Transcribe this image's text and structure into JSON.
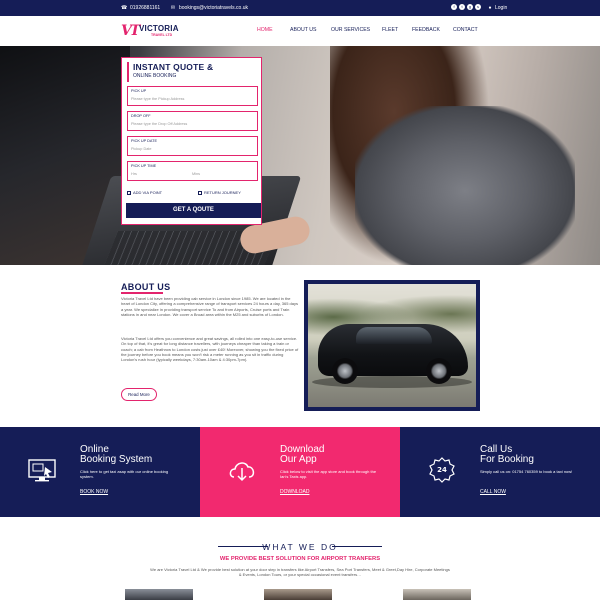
{
  "topbar": {
    "phone": "01926881161",
    "email": "bookings@victoriatravels.co.uk",
    "login": "Login",
    "socials": [
      "facebook",
      "twitter",
      "google-plus",
      "skype"
    ]
  },
  "logo": {
    "mark": "VT",
    "name": "VICTORIA",
    "sub": "TRAVEL LTD"
  },
  "nav": {
    "items": [
      "HOME",
      "ABOUT US",
      "OUR SERVICES",
      "FLEET",
      "FEEDBACK",
      "CONTACT"
    ],
    "active": "HOME"
  },
  "quote": {
    "title": "INSTANT QUOTE &",
    "subtitle": "ONLINE BOOKING",
    "pickup_label": "PICK UP",
    "pickup_placeholder": "Please type the Pickup Address",
    "dropoff_label": "DROP OFF",
    "dropoff_placeholder": "Please type the Drop Off Address",
    "date_label": "PICK UP DATE",
    "date_placeholder": "Pickup Date",
    "time_label": "PICK UP TIME",
    "hrs_placeholder": "Hrs",
    "mins_placeholder": "Mins",
    "via_label": "ADD VIA POINT",
    "via_checked": true,
    "return_label": "RETURN JOURNEY",
    "return_checked": false,
    "button": "GET A QOUTE"
  },
  "about": {
    "title": "ABOUT US",
    "p1": "Victoria Travel Ltd have been providing cab service in London since 1985. We are located in the heart of London City, offering a comprehensive range of transport services 24 hours a day, 365 days a year. We specialize in providing transport service To and from Airports, Cruise ports and Train stations in and near London. We cover a Broad area within the M25 and suburbs of London.",
    "p2": "Victoria Travel Ltd offers you convenience and great savings, all rolled into one easy-to-use service. On top of that, it's great for long distance travellers, with journeys cheaper than taking a train or coach; a cab from Heathrow to London costs just over £40! Moreover, showing you the fixed price of the journey before you book means you won't risk a meter running as you sit in traffic during London's rush hour (typically weekdays, 7:30am-10am & 4:30pm-7pm).",
    "read_more": "Read More"
  },
  "features": [
    {
      "title1": "Online",
      "title2": "Booking System",
      "desc": "Click here to get taxi asap with our online booking system.",
      "link": "BOOK NOW",
      "icon": "booking-screen-icon",
      "bg": "#151d57"
    },
    {
      "title1": "Download",
      "title2": "Our App",
      "desc": "Click below to visit the app store and book through the Ian's Taxis app.",
      "link": "DOWNLOAD",
      "icon": "cloud-download-icon",
      "bg": "#f2296f"
    },
    {
      "title1": "Call Us",
      "title2": "For Booking",
      "desc": "Simply call us on: 01754 760359 to book a taxi now!",
      "link": "CALL NOW",
      "icon": "24-hour-phone-icon",
      "bg": "#151d57"
    }
  ],
  "what_we_do": {
    "title": "WHAT WE DO",
    "subtitle": "WE PROVIDE BEST SOLUTION FOR AIRPORT TRANFERS",
    "text": "We are Victoria Travel Ltd & We provide best solution at your door step in transfers like Airport Transfers, Sea Port Transfers, Meet & Greet,Day Hire, Corporate Meetings & Events, London Tours, or your special occasional event transfers…"
  },
  "colors": {
    "navy": "#151d57",
    "pink": "#e3246d",
    "pink_bright": "#f2296f"
  }
}
